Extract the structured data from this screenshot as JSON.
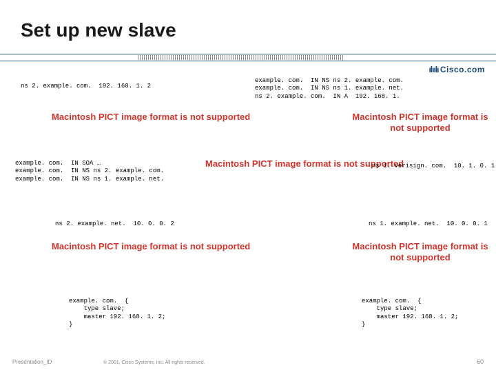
{
  "title": "Set up new slave",
  "logo_text": "Cisco.com",
  "blocks": {
    "top_left": "ns 2. example. com.  192. 168. 1. 2",
    "top_right": "example. com.  IN NS ns 2. example. com.\nexample. com.  IN NS ns 1. example. net.\nns 2. example. com.  IN A  192. 168. 1.",
    "mid_left": "example. com.  IN SOA …\nexample. com.  IN NS ns 2. example. com.\nexample. com.  IN NS ns 1. example. net.",
    "mid_right": "ns 1. verisign. com.  10. 1. 0. 1",
    "net_left": "ns 2. example. net.  10. 0. 0. 2",
    "net_right": "ns 1. example. net.  10. 0. 0. 1",
    "conf_left": "example. com.  {\n    type slave;\n    master 192. 168. 1. 2;\n}",
    "conf_right": "example. com.  {\n    type slave;\n    master 192. 168. 1. 2;\n}"
  },
  "pict_text": "Macintosh PICT\nimage format\nis not supported",
  "footer": {
    "left": "Presentation_ID",
    "mid": "© 2001, Cisco Systems, Inc. All rights reserved.",
    "right": "60"
  }
}
